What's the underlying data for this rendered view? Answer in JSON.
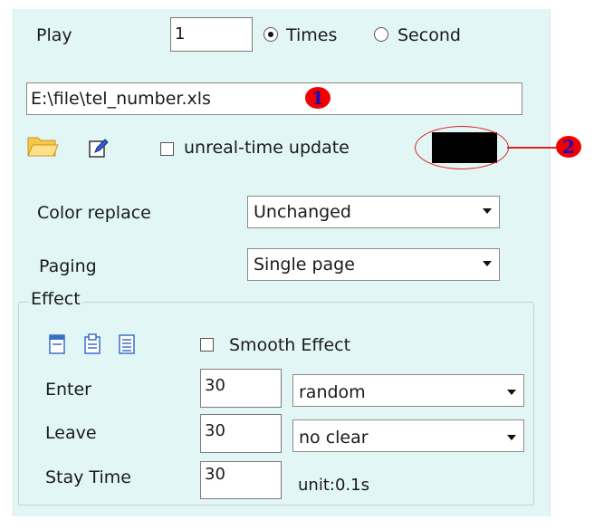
{
  "play": {
    "label": "Play",
    "count": "1",
    "options": [
      "Times",
      "Second"
    ],
    "selected": "Times"
  },
  "file": {
    "path": "E:\\file\\tel_number.xls"
  },
  "toolbar": {
    "open_icon": "folder-open-icon",
    "edit_icon": "pencil-edit-icon"
  },
  "update": {
    "label": "unreal-time update",
    "checked": false
  },
  "color_swatch": {
    "color": "#000000"
  },
  "color_replace": {
    "label": "Color replace",
    "value": "Unchanged"
  },
  "paging": {
    "label": "Paging",
    "value": "Single page"
  },
  "effect": {
    "legend": "Effect",
    "icons": [
      "align-top-icon",
      "align-center-icon",
      "align-list-icon"
    ],
    "smooth_label": "Smooth Effect",
    "smooth_checked": false,
    "enter": {
      "label": "Enter",
      "value": "30",
      "mode": "random"
    },
    "leave": {
      "label": "Leave",
      "value": "30",
      "mode": "no clear"
    },
    "stay": {
      "label": "Stay Time",
      "value": "30",
      "unit": "unit:0.1s"
    }
  },
  "annotations": {
    "marker1": "1",
    "marker2": "2",
    "color": "#f20000"
  }
}
